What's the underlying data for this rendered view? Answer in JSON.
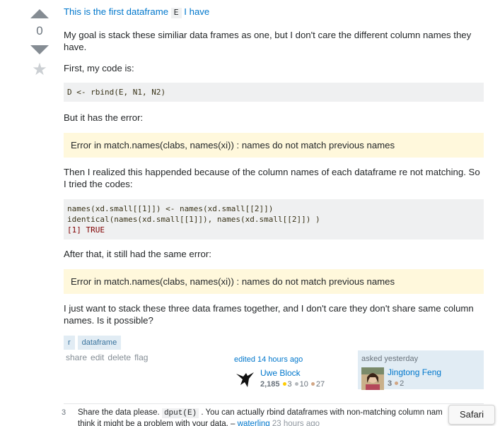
{
  "vote": {
    "count": "0"
  },
  "post": {
    "title_text": "This is the first dataframe",
    "title_code": "E",
    "title_suffix": "I have",
    "p1": "My goal is stack these similiar data frames as one, but I don't care the different column names they have.",
    "p2": "First, my code is:",
    "code1": "D <- rbind(E, N1, N2)",
    "p3": "But it has the error:",
    "error1": "Error in match.names(clabs, names(xi)) : names do not match previous names",
    "p4": "Then I realized this happended because of the column names of each dataframe re not matching. So I tried the codes:",
    "code2_line1": "names(xd.small[[1]]) <- names(xd.small[[2]])",
    "code2_line2": "identical(names(xd.small[[1]]), names(xd.small[[2]]) )",
    "code2_line3a": "[1] ",
    "code2_line3b": "TRUE",
    "p5": "After that, it still had the same error:",
    "error2": "Error in match.names(clabs, names(xi)) : names do not match previous names",
    "p6": "I just want to stack these three data frames together, and I don't care they don't share same column names. Is it possible?"
  },
  "tags": [
    "r",
    "dataframe"
  ],
  "menu": {
    "share": "share",
    "edit": "edit",
    "delete": "delete",
    "flag": "flag"
  },
  "edited": {
    "action": "edited 14 hours ago",
    "name": "Uwe Block",
    "rep": "2,185",
    "gold": "3",
    "silver": "10",
    "bronze": "27"
  },
  "asked": {
    "action": "asked yesterday",
    "name": "Jingtong Feng",
    "rep": "3",
    "bronze": "2"
  },
  "comment": {
    "score": "3",
    "text1": "Share the data please.",
    "code": "dput(E)",
    "text2": ". You can actually rbind dataframes with non-matching column nam",
    "text3": "think it might be a problem with your data. –",
    "author": "waterling",
    "date": "23 hours ago"
  },
  "safari": {
    "label": "Safari"
  },
  "colors": {
    "link": "#0077cc",
    "tag_bg": "#e1ecf4",
    "tag_fg": "#39739d",
    "error_bg": "#fff8dc",
    "code_bg": "#eff0f1",
    "gold": "#ffcc01",
    "silver": "#b4b8bc",
    "bronze": "#d1a684"
  }
}
